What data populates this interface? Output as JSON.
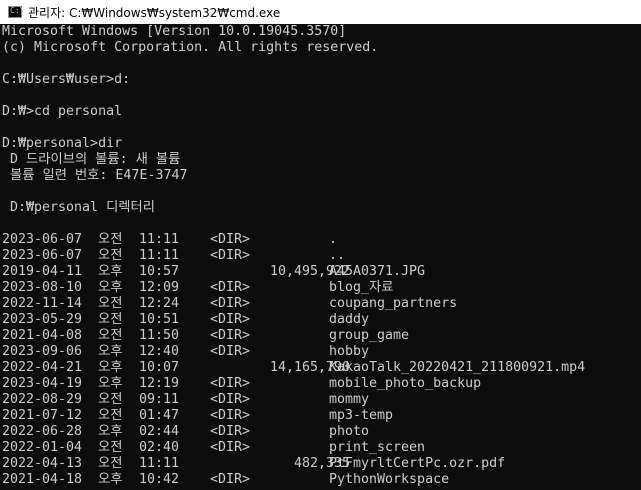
{
  "window": {
    "title": "관리자: C:₩Windows₩system32₩cmd.exe",
    "icon": "cmd-console-icon"
  },
  "console": {
    "lines": [
      "Microsoft Windows [Version 10.0.19045.3570]",
      "(c) Microsoft Corporation. All rights reserved.",
      "",
      "C:₩Users₩user>d:",
      "",
      "D:₩>cd personal",
      "",
      "D:₩personal>dir",
      " D 드라이브의 볼륨: 새 볼륨",
      " 볼륨 일련 번호: E47E-3747",
      "",
      " D:₩personal 디렉터리",
      ""
    ],
    "entries": [
      {
        "date": "2023-06-07",
        "ampm": "오전",
        "time": "11:11",
        "kind": "<DIR>",
        "size": "",
        "name": "."
      },
      {
        "date": "2023-06-07",
        "ampm": "오전",
        "time": "11:11",
        "kind": "<DIR>",
        "size": "",
        "name": ".."
      },
      {
        "date": "2019-04-11",
        "ampm": "오후",
        "time": "10:57",
        "kind": "",
        "size": "10,495,922",
        "name": "A45A0371.JPG"
      },
      {
        "date": "2023-08-10",
        "ampm": "오후",
        "time": "12:09",
        "kind": "<DIR>",
        "size": "",
        "name": "blog_자료"
      },
      {
        "date": "2022-11-14",
        "ampm": "오전",
        "time": "12:24",
        "kind": "<DIR>",
        "size": "",
        "name": "coupang_partners"
      },
      {
        "date": "2023-05-29",
        "ampm": "오전",
        "time": "10:51",
        "kind": "<DIR>",
        "size": "",
        "name": "daddy"
      },
      {
        "date": "2021-04-08",
        "ampm": "오전",
        "time": "11:50",
        "kind": "<DIR>",
        "size": "",
        "name": "group_game"
      },
      {
        "date": "2023-09-06",
        "ampm": "오후",
        "time": "12:40",
        "kind": "<DIR>",
        "size": "",
        "name": "hobby"
      },
      {
        "date": "2022-04-21",
        "ampm": "오후",
        "time": "10:07",
        "kind": "",
        "size": "14,165,790",
        "name": "KakaoTalk_20220421_211800921.mp4"
      },
      {
        "date": "2023-04-19",
        "ampm": "오후",
        "time": "12:19",
        "kind": "<DIR>",
        "size": "",
        "name": "mobile_photo_backup"
      },
      {
        "date": "2022-08-29",
        "ampm": "오전",
        "time": "09:11",
        "kind": "<DIR>",
        "size": "",
        "name": "mommy"
      },
      {
        "date": "2021-07-12",
        "ampm": "오전",
        "time": "01:47",
        "kind": "<DIR>",
        "size": "",
        "name": "mp3-temp"
      },
      {
        "date": "2022-06-28",
        "ampm": "오후",
        "time": "02:44",
        "kind": "<DIR>",
        "size": "",
        "name": "photo"
      },
      {
        "date": "2022-01-04",
        "ampm": "오전",
        "time": "02:40",
        "kind": "<DIR>",
        "size": "",
        "name": "print_screen"
      },
      {
        "date": "2022-04-13",
        "ampm": "오전",
        "time": "11:11",
        "kind": "",
        "size": "482,335",
        "name": "PtFmyrltCertPc.ozr.pdf"
      },
      {
        "date": "2021-04-18",
        "ampm": "오후",
        "time": "10:42",
        "kind": "<DIR>",
        "size": "",
        "name": "PythonWorkspace"
      }
    ]
  },
  "colors": {
    "console_bg": "#0c0c0c",
    "console_fg": "#cccccc",
    "titlebar_bg": "#ffffff"
  }
}
